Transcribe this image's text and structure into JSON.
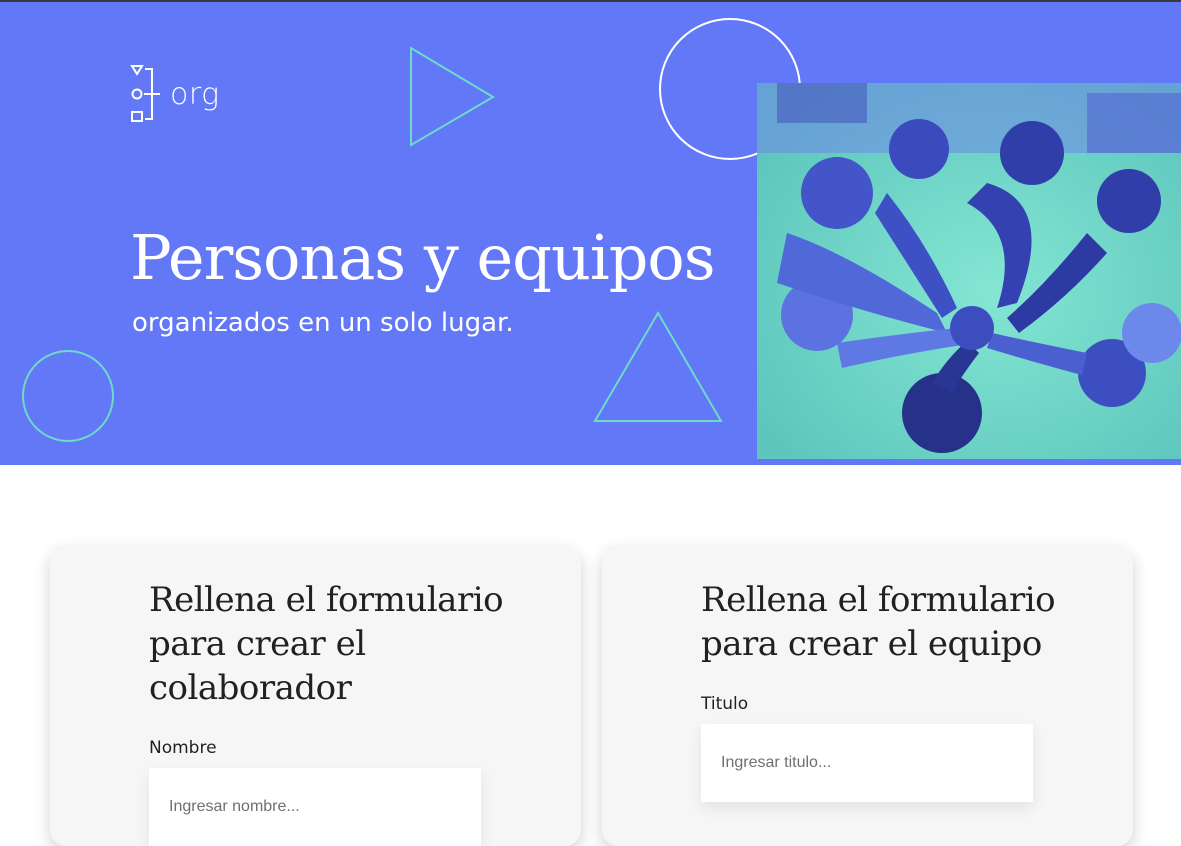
{
  "header": {
    "logo_text": "org",
    "title": "Personas y equipos",
    "subtitle": "organizados en un solo lugar.",
    "photo_alt": "Grupo de personas uniendo sus manos en el centro"
  },
  "colors": {
    "hero_background": "#6278f7",
    "accent_teal": "#6ddbca",
    "card_background": "#f6f6f6"
  },
  "icons": [
    "logo-icon",
    "play-triangle-icon",
    "circle-outline-icon",
    "triangle-outline-icon"
  ],
  "collaborator_form": {
    "title": "Rellena el formulario para crear el colaborador",
    "name_label": "Nombre",
    "name_placeholder": "Ingresar nombre..."
  },
  "team_form": {
    "title": "Rellena el formulario para crear el equipo",
    "title_label": "Titulo",
    "title_placeholder": "Ingresar titulo..."
  }
}
